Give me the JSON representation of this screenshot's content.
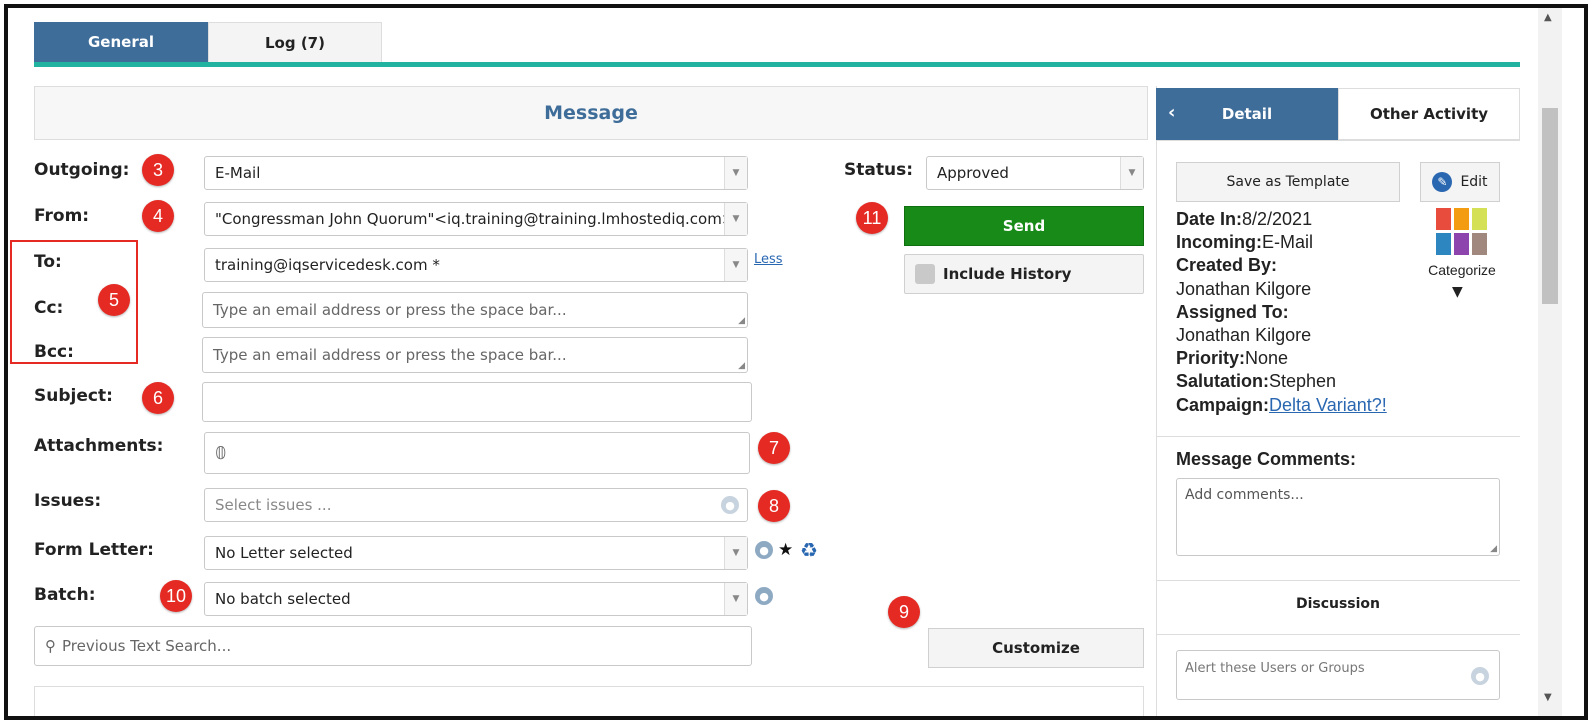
{
  "tabs": {
    "general": "General",
    "log": "Log (7)"
  },
  "message": {
    "header": "Message",
    "outgoing": {
      "label": "Outgoing:",
      "value": "E-Mail"
    },
    "from": {
      "label": "From:",
      "value": "\"Congressman John Quorum\"<iq.training@training.lmhostediq.com>"
    },
    "to": {
      "label": "To:",
      "value": "training@iqservicedesk.com *",
      "less_link": "Less"
    },
    "cc": {
      "label": "Cc:",
      "placeholder": "Type an email address or press the space bar..."
    },
    "bcc": {
      "label": "Bcc:",
      "placeholder": "Type an email address or press the space bar..."
    },
    "subject": {
      "label": "Subject:",
      "value": ""
    },
    "attachments": {
      "label": "Attachments:"
    },
    "issues": {
      "label": "Issues:",
      "placeholder": "Select issues ..."
    },
    "form_letter": {
      "label": "Form Letter:",
      "value": "No Letter selected"
    },
    "batch": {
      "label": "Batch:",
      "value": "No batch selected"
    },
    "text_search": {
      "placeholder": "Previous Text Search..."
    },
    "status": {
      "label": "Status:",
      "value": "Approved"
    },
    "send_label": "Send",
    "include_history_label": "Include History",
    "customize_label": "Customize"
  },
  "badges": [
    "3",
    "4",
    "5",
    "6",
    "7",
    "8",
    "9",
    "10",
    "11"
  ],
  "detail_panel": {
    "tabs": {
      "detail": "Detail",
      "other": "Other Activity"
    },
    "save_template": "Save as Template",
    "edit": "Edit",
    "categorize": "Categorize",
    "fields": {
      "date_in_label": "Date In:",
      "date_in": "8/2/2021",
      "incoming_label": "Incoming:",
      "incoming": "E-Mail",
      "created_by_label": "Created By:",
      "created_by": "Jonathan Kilgore",
      "assigned_to_label": "Assigned To:",
      "assigned_to": "Jonathan Kilgore",
      "priority_label": "Priority:",
      "priority": "None",
      "salutation_label": "Salutation:",
      "salutation": "Stephen",
      "campaign_label": "Campaign:",
      "campaign": "Delta Variant?!"
    },
    "comments_title": "Message Comments:",
    "comments_placeholder": "Add comments...",
    "discussion_title": "Discussion",
    "alert_placeholder": "Alert these Users or Groups"
  },
  "colors": {
    "tab_active": "#3f6d9a",
    "teal_line": "#21b3a0",
    "send_green": "#178a17",
    "badge_red": "#e52a24",
    "link_blue": "#2a67b1",
    "categorize": [
      "#e74c3c",
      "#f39c12",
      "#d4e157",
      "#2e86c1",
      "#8e44ad",
      "#a1887f"
    ]
  }
}
